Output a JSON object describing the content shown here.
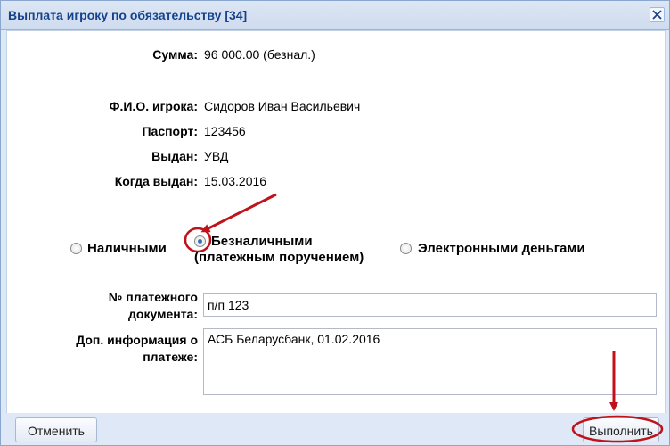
{
  "window": {
    "title": "Выплата игроку по обязательству [34]",
    "close_icon": "close-icon"
  },
  "details": {
    "sum_label": "Сумма:",
    "sum_value": "96 000.00 (безнал.)",
    "player_label": "Ф.И.О. игрока:",
    "player_value": "Сидоров Иван Васильевич",
    "passport_label": "Паспорт:",
    "passport_value": "123456",
    "issued_by_label": "Выдан:",
    "issued_by_value": "УВД",
    "issued_date_label": "Когда выдан:",
    "issued_date_value": "15.03.2016"
  },
  "payment_method": {
    "selected": "Безналичными (платежным поручением)",
    "options": [
      {
        "label": "Наличными",
        "checked": false
      },
      {
        "label_line1": "Безналичными",
        "label_line2": "(платежным поручением)",
        "checked": true
      },
      {
        "label": "Электронными деньгами",
        "checked": false
      }
    ]
  },
  "form": {
    "doc_number_label_line1": "№ платежного",
    "doc_number_label_line2": "документа:",
    "doc_number_value": "п/п 123",
    "extra_info_label_line1": "Доп. информация о",
    "extra_info_label_line2": "платеже:",
    "extra_info_value": "АСБ Беларусбанк, 01.02.2016"
  },
  "footer": {
    "cancel_label": "Отменить",
    "submit_label": "Выполнить"
  },
  "colors": {
    "title_text": "#15428b",
    "annotation": "#c0121a",
    "window_bg": "#dfe8f6"
  }
}
